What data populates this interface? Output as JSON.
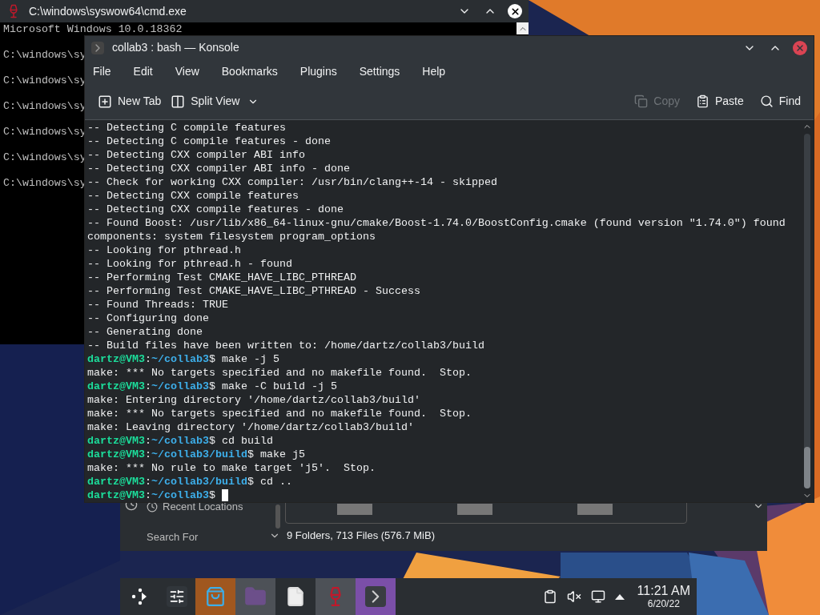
{
  "cmd_window": {
    "title": "C:\\windows\\syswow64\\cmd.exe",
    "lines": [
      "Microsoft Windows 10.0.18362",
      "C:\\windows\\sy",
      "C:\\windows\\sy",
      "C:\\windows\\sy",
      "C:\\windows\\sy",
      "C:\\windows\\sy",
      "C:\\windows\\sy"
    ]
  },
  "konsole": {
    "title": "collab3 : bash — Konsole",
    "menu": [
      "File",
      "Edit",
      "View",
      "Bookmarks",
      "Plugins",
      "Settings",
      "Help"
    ],
    "toolbar_left": [
      {
        "kind": "new-tab",
        "label": "New Tab"
      },
      {
        "kind": "split-view",
        "label": "Split View"
      }
    ],
    "toolbar_right": [
      {
        "kind": "copy",
        "label": "Copy",
        "disabled": true
      },
      {
        "kind": "paste",
        "label": "Paste",
        "disabled": false
      },
      {
        "kind": "find",
        "label": "Find",
        "disabled": false
      }
    ],
    "lines": [
      {
        "kind": "output",
        "text": "-- Detecting C compile features"
      },
      {
        "kind": "output",
        "text": "-- Detecting C compile features - done"
      },
      {
        "kind": "output",
        "text": "-- Detecting CXX compiler ABI info"
      },
      {
        "kind": "output",
        "text": "-- Detecting CXX compiler ABI info - done"
      },
      {
        "kind": "output",
        "text": "-- Check for working CXX compiler: /usr/bin/clang++-14 - skipped"
      },
      {
        "kind": "output",
        "text": "-- Detecting CXX compile features"
      },
      {
        "kind": "output",
        "text": "-- Detecting CXX compile features - done"
      },
      {
        "kind": "output",
        "text": "-- Found Boost: /usr/lib/x86_64-linux-gnu/cmake/Boost-1.74.0/BoostConfig.cmake (found version \"1.74.0\") found"
      },
      {
        "kind": "output",
        "text": "components: system filesystem program_options"
      },
      {
        "kind": "output",
        "text": "-- Looking for pthread.h"
      },
      {
        "kind": "output",
        "text": "-- Looking for pthread.h - found"
      },
      {
        "kind": "output",
        "text": "-- Performing Test CMAKE_HAVE_LIBC_PTHREAD"
      },
      {
        "kind": "output",
        "text": "-- Performing Test CMAKE_HAVE_LIBC_PTHREAD - Success"
      },
      {
        "kind": "output",
        "text": "-- Found Threads: TRUE"
      },
      {
        "kind": "output",
        "text": "-- Configuring done"
      },
      {
        "kind": "output",
        "text": "-- Generating done"
      },
      {
        "kind": "output",
        "text": "-- Build files have been written to: /home/dartz/collab3/build"
      },
      {
        "kind": "prompt",
        "user": "dartz@VM3",
        "sep": ":",
        "path": "~/collab3",
        "symbol": "$",
        "command": "make -j 5",
        "cursor": false
      },
      {
        "kind": "output",
        "text": "make: *** No targets specified and no makefile found.  Stop."
      },
      {
        "kind": "prompt",
        "user": "dartz@VM3",
        "sep": ":",
        "path": "~/collab3",
        "symbol": "$",
        "command": "make -C build -j 5",
        "cursor": false
      },
      {
        "kind": "output",
        "text": "make: Entering directory '/home/dartz/collab3/build'"
      },
      {
        "kind": "output",
        "text": "make: *** No targets specified and no makefile found.  Stop."
      },
      {
        "kind": "output",
        "text": "make: Leaving directory '/home/dartz/collab3/build'"
      },
      {
        "kind": "prompt",
        "user": "dartz@VM3",
        "sep": ":",
        "path": "~/collab3",
        "symbol": "$",
        "command": "cd build",
        "cursor": false
      },
      {
        "kind": "prompt",
        "user": "dartz@VM3",
        "sep": ":",
        "path": "~/collab3/build",
        "symbol": "$",
        "command": "make j5",
        "cursor": false
      },
      {
        "kind": "output",
        "text": "make: *** No rule to make target 'j5'.  Stop."
      },
      {
        "kind": "prompt",
        "user": "dartz@VM3",
        "sep": ":",
        "path": "~/collab3/build",
        "symbol": "$",
        "command": "cd ..",
        "cursor": false
      },
      {
        "kind": "prompt",
        "user": "dartz@VM3",
        "sep": ":",
        "path": "~/collab3",
        "symbol": "$",
        "cursor": true
      }
    ]
  },
  "file_manager": {
    "places": [
      "Recent Locations",
      "Search For"
    ],
    "status": "9 Folders, 713 Files (576.7 MiB)"
  },
  "taskbar": {
    "tasks": [
      {
        "kind": "launcher"
      },
      {
        "kind": "settings"
      },
      {
        "kind": "store"
      },
      {
        "kind": "folder"
      },
      {
        "kind": "document"
      },
      {
        "kind": "wine"
      },
      {
        "kind": "terminal"
      }
    ],
    "tray": [
      {
        "kind": "clipboard"
      },
      {
        "kind": "muted"
      },
      {
        "kind": "network"
      },
      {
        "kind": "expand"
      }
    ],
    "clock": {
      "time": "11:21 AM",
      "date": "6/20/22"
    }
  }
}
